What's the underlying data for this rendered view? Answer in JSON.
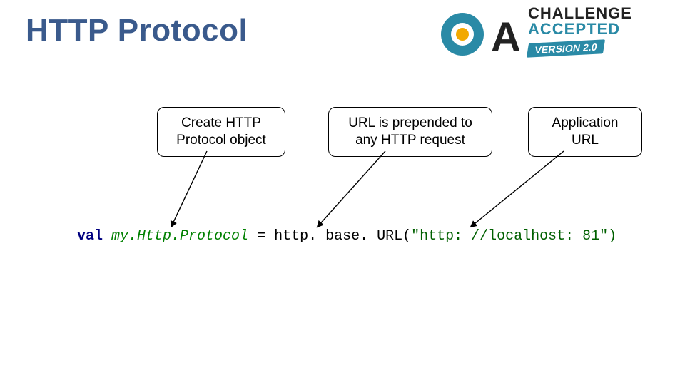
{
  "title": "HTTP Protocol",
  "logo": {
    "word1": "CHALLENGE",
    "word2": "ACCEPTED",
    "version": "VERSION 2.0",
    "letter_o": "O",
    "letter_a": "A"
  },
  "callouts": {
    "c1": "Create HTTP Protocol object",
    "c2": "URL is prepended to any HTTP request",
    "c3": "Application URL"
  },
  "code": {
    "kw": "val",
    "var": " my.Http.Protocol",
    "mid": " = http. base. URL(",
    "str": "\"http: //localhost: 81\"",
    "end": ")"
  }
}
